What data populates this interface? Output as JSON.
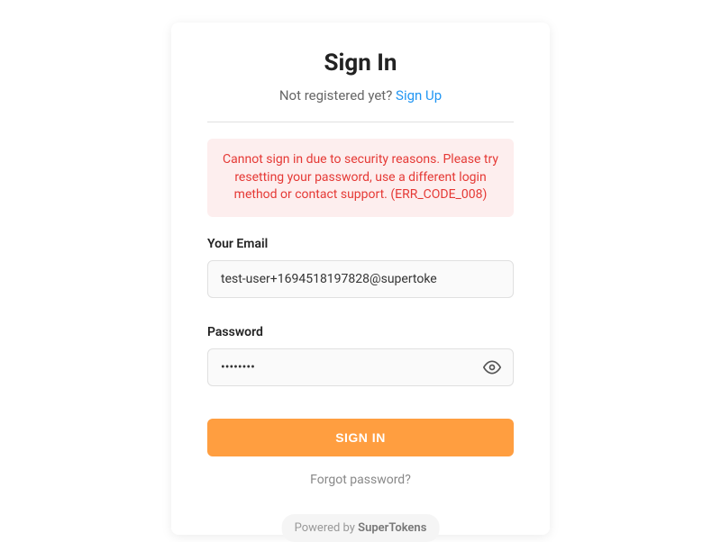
{
  "header": {
    "title": "Sign In",
    "subtitle_prefix": "Not registered yet? ",
    "signup_link": "Sign Up"
  },
  "error": {
    "message": "Cannot sign in due to security reasons. Please try resetting your password, use a different login method or contact support. (ERR_CODE_008)"
  },
  "fields": {
    "email": {
      "label": "Your Email",
      "value": "test-user+1694518197828@supertoke"
    },
    "password": {
      "label": "Password",
      "value": "••••••••"
    }
  },
  "actions": {
    "signin_button": "SIGN IN",
    "forgot_password": "Forgot password?"
  },
  "footer": {
    "prefix": "Powered by ",
    "brand": "SuperTokens"
  }
}
